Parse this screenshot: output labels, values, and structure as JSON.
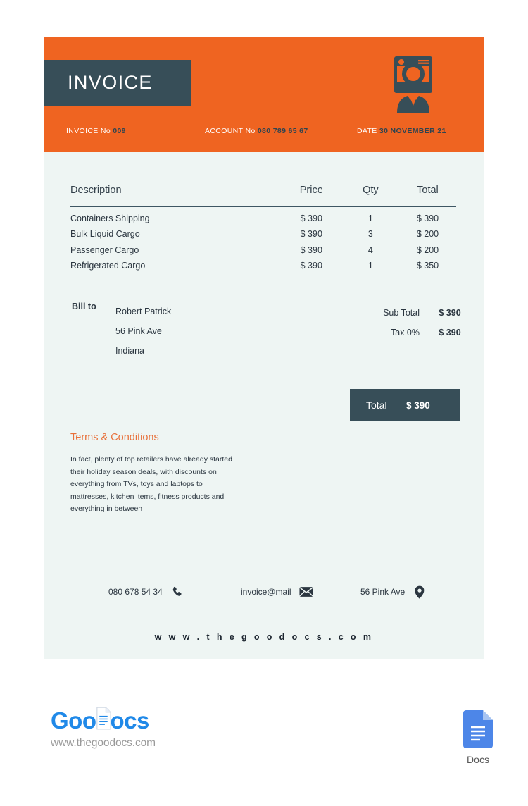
{
  "document": {
    "title_tag": "INVOICE",
    "logo_icon": "person-badge-icon"
  },
  "header": {
    "meta": [
      {
        "label": "INVOICE No",
        "value": "009",
        "name": "invoice-number"
      },
      {
        "label": "ACCOUNT No",
        "value": "080 789 65 67",
        "name": "account-number"
      },
      {
        "label": "DATE",
        "value": "30 NOVEMBER 21",
        "name": "invoice-date"
      }
    ]
  },
  "table": {
    "columns": [
      "Description",
      "Price",
      "Qty",
      "Total"
    ],
    "rows": [
      {
        "description": "Containers Shipping",
        "price": "$ 390",
        "qty": "1",
        "total": "$ 390"
      },
      {
        "description": "Bulk Liquid Cargo",
        "price": "$ 390",
        "qty": "3",
        "total": "$ 200"
      },
      {
        "description": "Passenger Cargo",
        "price": "$ 390",
        "qty": "4",
        "total": "$ 200"
      },
      {
        "description": "Refrigerated Cargo",
        "price": "$ 390",
        "qty": "1",
        "total": "$ 350"
      }
    ]
  },
  "bill_to": {
    "label": "Bill to",
    "lines": [
      "Robert Patrick",
      "56 Pink Ave",
      "Indiana"
    ]
  },
  "summary": {
    "rows": [
      {
        "label": "Sub Total",
        "value": "$ 390"
      },
      {
        "label": "Tax 0%",
        "value": "$ 390"
      }
    ],
    "total_label": "Total",
    "total_value": "$ 390"
  },
  "terms": {
    "title": "Terms & Conditions",
    "body": "In fact, plenty of top retailers have already started their holiday season deals, with discounts on everything from TVs, toys and laptops to mattresses, kitchen items, fitness products and everything in between"
  },
  "contacts": {
    "phone": "080 678 54 34",
    "email": "invoice@mail",
    "address": "56 Pink Ave",
    "website": "w w w . t h e g o o d o c s . c o m"
  },
  "branding": {
    "name_part1": "Goo",
    "name_part2": "ocs",
    "url": "www.thegoodocs.com",
    "docs_label": "Docs"
  },
  "colors": {
    "orange": "#ef6421",
    "dark_slate": "#374e58",
    "page_bg": "#eef5f3",
    "terms_accent": "#e8703a",
    "brand_blue": "#2089e8",
    "docs_blue": "#4d86e8"
  }
}
